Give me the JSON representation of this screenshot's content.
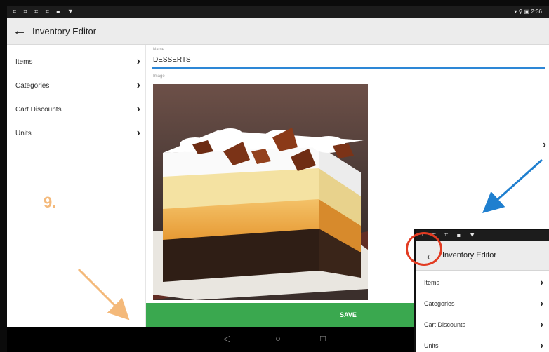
{
  "status_bar": {
    "left_icons": "⌗ ⌗ ⌗ ⌗ ◼ ▼",
    "right_text": "▾ ⚲ ▣ 2:36"
  },
  "app_bar": {
    "back_icon": "back-arrow-icon",
    "title": "Inventory Editor"
  },
  "sidebar": {
    "items": [
      {
        "label": "Items",
        "chevron": "›"
      },
      {
        "label": "Categories",
        "chevron": "›"
      },
      {
        "label": "Cart Discounts",
        "chevron": "›"
      },
      {
        "label": "Units",
        "chevron": "›"
      }
    ]
  },
  "form": {
    "name_caption": "Name",
    "name_value": "DESSERTS",
    "image_caption": "Image"
  },
  "save_button": {
    "label": "SAVE"
  },
  "nav_bar": {
    "back": "◁",
    "home": "○",
    "recent": "□"
  },
  "annotation": {
    "step": "9."
  },
  "zoom_panel": {
    "status_icons": "⌗ ⌗ ⌗ ◼ ▼",
    "title": "Inventory Editor",
    "items": [
      {
        "label": "Items",
        "chevron": "›"
      },
      {
        "label": "Categories",
        "chevron": "›"
      },
      {
        "label": "Cart Discounts",
        "chevron": "›"
      },
      {
        "label": "Units",
        "chevron": "›"
      }
    ]
  },
  "colors": {
    "accent_underline": "#2d87d6",
    "save_green": "#3aa84f",
    "step_orange": "#f4b97a",
    "pointer_blue": "#1f7fcf",
    "highlight_red": "#e23b22"
  }
}
